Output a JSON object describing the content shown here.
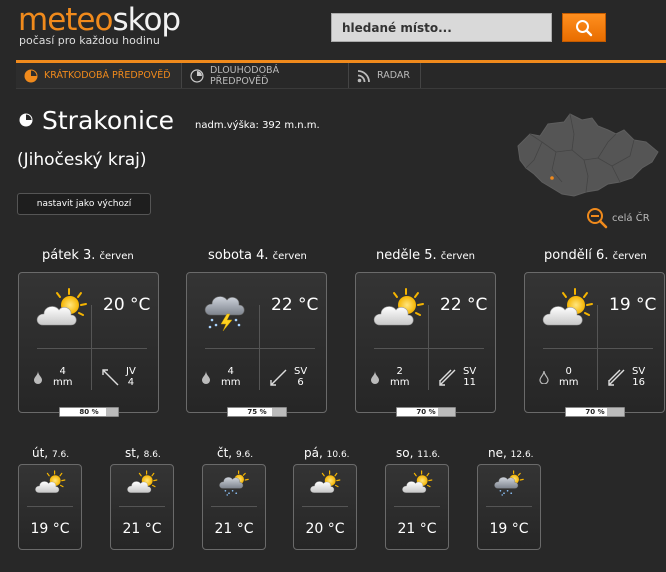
{
  "header": {
    "logo_part1": "meteo",
    "logo_part2": "skop",
    "tagline": "počasí pro každou hodinu",
    "search_placeholder": "hledané místo..."
  },
  "nav": {
    "tabs": [
      {
        "label": "KRÁTKODOBÁ PŘEDPOVĚĎ",
        "active": true,
        "icon": "clock-icon"
      },
      {
        "label": "DLOUHODOBÁ PŘEDPOVĚĎ",
        "active": false,
        "icon": "clock-icon"
      },
      {
        "label": "RADAR",
        "active": false,
        "icon": "radar-icon"
      }
    ]
  },
  "location": {
    "city": "Strakonice",
    "altitude": "nadm.výška: 392 m.n.m.",
    "region": "(Jihočeský kraj)",
    "set_default_label": "nastavit jako výchozí",
    "map_link_label": "celá ČR"
  },
  "days": [
    {
      "day": "pátek 3.",
      "month": "červen",
      "icon": "sun-cloud-icon",
      "temp": "20 °C",
      "precip_value": "4",
      "precip_unit": "mm",
      "wind_dir": "JV",
      "wind_speed": "4",
      "probability": 80,
      "probability_label": "80 %"
    },
    {
      "day": "sobota 4.",
      "month": "červen",
      "icon": "storm-icon",
      "temp": "22 °C",
      "precip_value": "4",
      "precip_unit": "mm",
      "wind_dir": "SV",
      "wind_speed": "6",
      "probability": 75,
      "probability_label": "75 %"
    },
    {
      "day": "neděle 5.",
      "month": "červen",
      "icon": "sun-cloud-icon",
      "temp": "22 °C",
      "precip_value": "2",
      "precip_unit": "mm",
      "wind_dir": "SV",
      "wind_speed": "11",
      "probability": 70,
      "probability_label": "70 %"
    },
    {
      "day": "pondělí 6.",
      "month": "červen",
      "icon": "sun-cloud-icon",
      "temp": "19 °C",
      "precip_value": "0",
      "precip_unit": "mm",
      "wind_dir": "SV",
      "wind_speed": "16",
      "probability": 70,
      "probability_label": "70 %"
    }
  ],
  "extended": [
    {
      "day": "út,",
      "date": "7.6.",
      "temp": "19 °C",
      "icon": "sun-cloud-icon"
    },
    {
      "day": "st,",
      "date": "8.6.",
      "temp": "21 °C",
      "icon": "sun-cloud-icon"
    },
    {
      "day": "čt,",
      "date": "9.6.",
      "temp": "21 °C",
      "icon": "rain-cloud-icon"
    },
    {
      "day": "pá,",
      "date": "10.6.",
      "temp": "20 °C",
      "icon": "sun-cloud-icon"
    },
    {
      "day": "so,",
      "date": "11.6.",
      "temp": "21 °C",
      "icon": "sun-cloud-icon"
    },
    {
      "day": "ne,",
      "date": "12.6.",
      "temp": "19 °C",
      "icon": "rain-cloud-icon"
    }
  ],
  "colors": {
    "accent": "#f08a1c",
    "background": "#282828"
  }
}
